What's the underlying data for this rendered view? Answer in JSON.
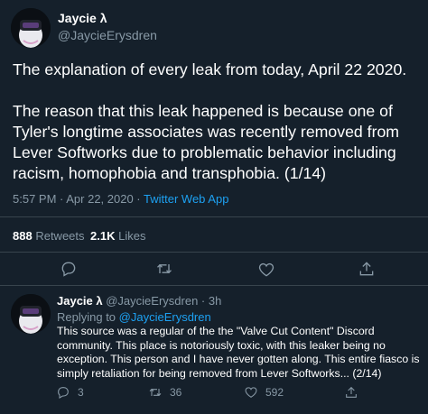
{
  "main_tweet": {
    "display_name": "Jaycie λ",
    "handle": "@JaycieErysdren",
    "paragraph1": "The explanation of every leak from today, April 22 2020.",
    "paragraph2": "The reason that this leak happened is because one of Tyler's longtime associates was recently removed from Lever Softworks due to problematic behavior including racism, homophobia and transphobia. (1/14)",
    "timestamp": "5:57 PM · Apr 22, 2020 · ",
    "source": "Twitter Web App",
    "retweets_count": "888",
    "retweets_label": "Retweets",
    "likes_count": "2.1K",
    "likes_label": "Likes"
  },
  "reply_tweet": {
    "display_name": "Jaycie λ",
    "handle": "@JaycieErysdren · 3h",
    "replying_to_label": "Replying to ",
    "replying_to_handle": "@JaycieErysdren",
    "text": "This source was a regular of the the \"Valve Cut Content\" Discord community. This place is notoriously toxic, with this leaker being no exception. This person and I have never gotten along. This entire fiasco is simply retaliation for being removed from Lever Softworks... (2/14)",
    "reply_count": "3",
    "retweet_count": "36",
    "like_count": "592"
  },
  "icons": {
    "reply": "reply-icon",
    "retweet": "retweet-icon",
    "like": "heart-icon",
    "share": "share-icon"
  },
  "colors": {
    "background": "#15202b",
    "text": "#ffffff",
    "muted": "#8899a6",
    "accent": "#1da1f2",
    "divider": "#38444d"
  }
}
